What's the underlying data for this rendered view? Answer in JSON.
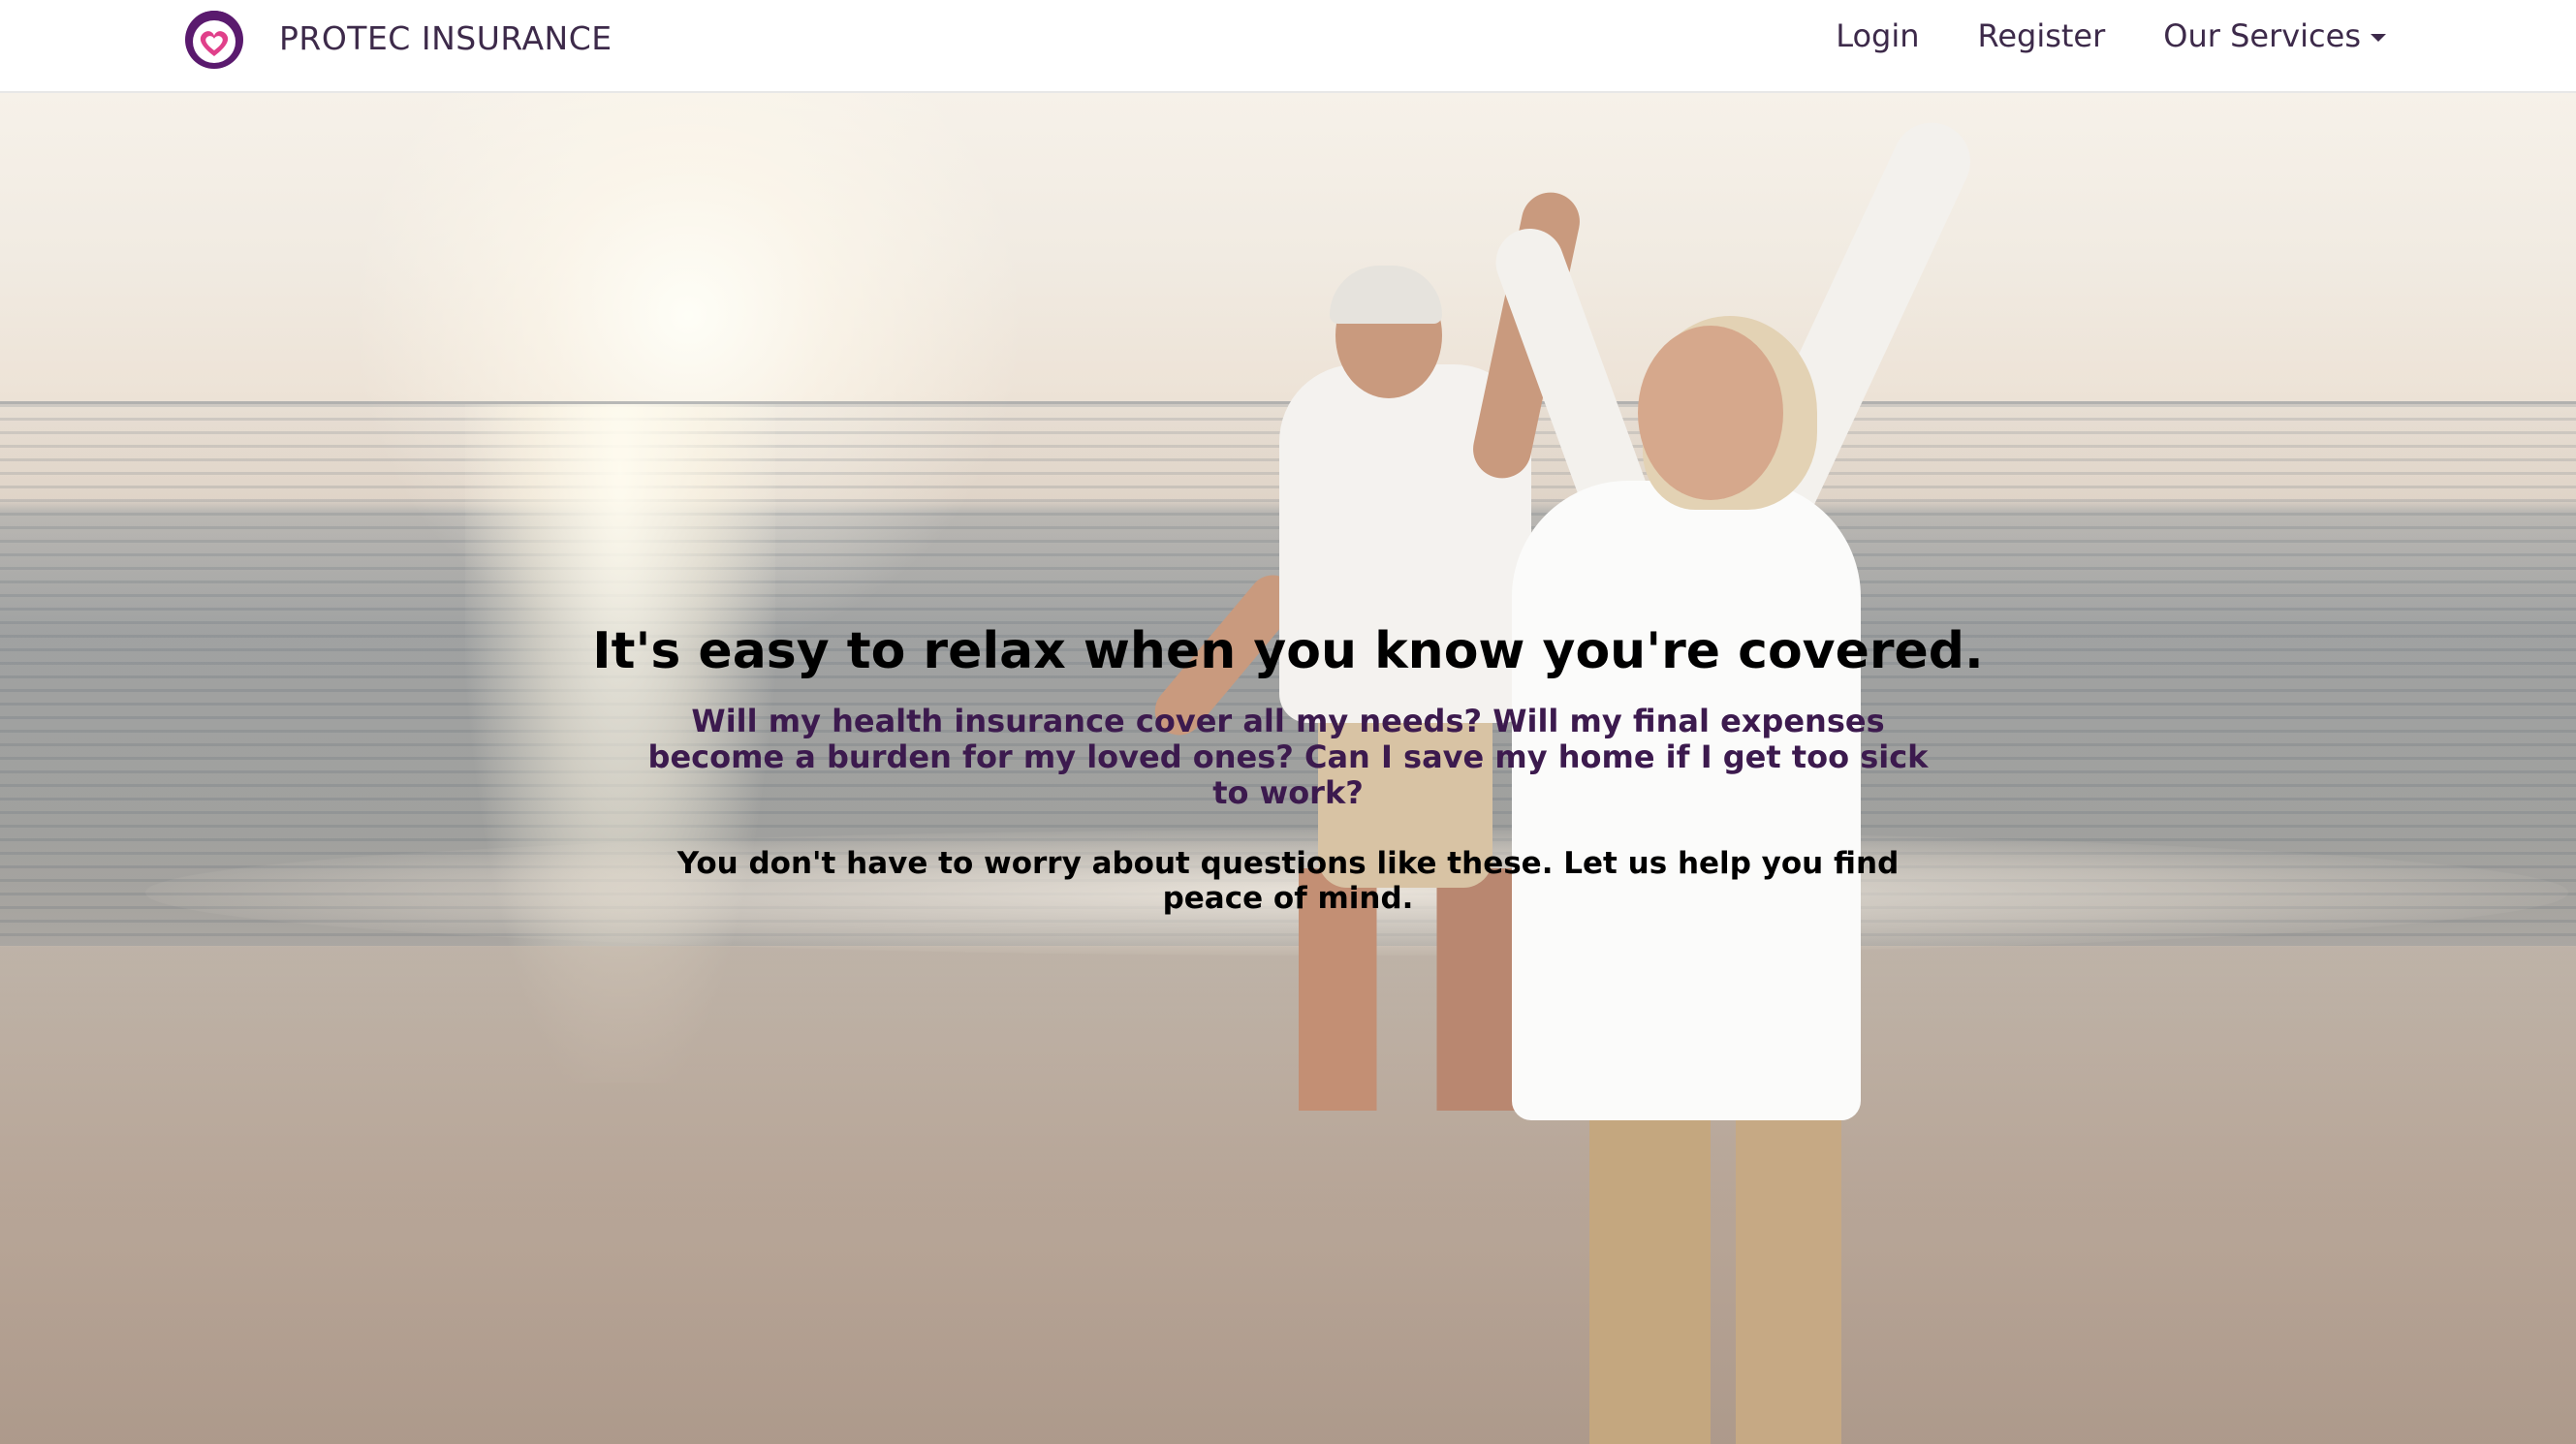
{
  "header": {
    "brand_name": "PROTEC INSURANCE",
    "logo_icon": "heart-shield-logo",
    "nav": {
      "login_label": "Login",
      "register_label": "Register",
      "services_label": "Our Services"
    }
  },
  "hero": {
    "background_image": "senior-couple-dancing-on-beach-at-sunset",
    "heading": "It's easy to relax when you know you're covered.",
    "questions": "Will my health insurance cover all my needs? Will my final expenses become a burden for my loved ones? Can I save my home if I get too sick to work?",
    "assurance": "You don't have to worry about questions like these. Let us help you find peace of mind."
  },
  "colors": {
    "brand_text": "#3d2a4a",
    "question_text": "#3c1a4e",
    "logo_purple": "#5a1a6e",
    "logo_pink": "#e0408a"
  }
}
